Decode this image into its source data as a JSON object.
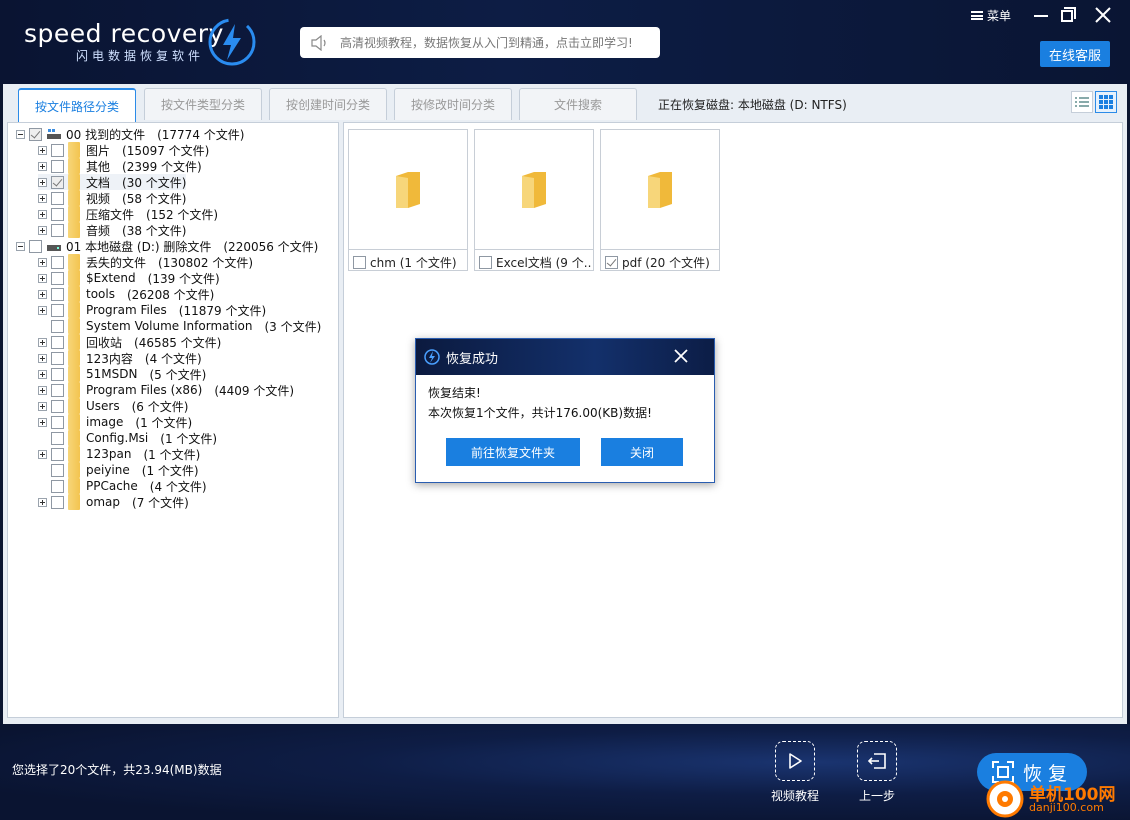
{
  "header": {
    "logo_en": "speed recovery",
    "logo_cn": "闪电数据恢复软件",
    "notice": "高清视频教程，数据恢复从入门到精通，点击立即学习!",
    "menu_label": "菜单",
    "online_service": "在线客服"
  },
  "tabs": [
    {
      "label": "按文件路径分类",
      "active": true
    },
    {
      "label": "按文件类型分类",
      "active": false
    },
    {
      "label": "按创建时间分类",
      "active": false
    },
    {
      "label": "按修改时间分类",
      "active": false
    },
    {
      "label": "文件搜索",
      "active": false
    }
  ],
  "disk_status": "正在恢复磁盘: 本地磁盘 (D: NTFS)",
  "tree": [
    {
      "name": "00 找到的文件",
      "count": "(17774 个文件)"
    },
    {
      "name": "图片",
      "count": "(15097 个文件)"
    },
    {
      "name": "其他",
      "count": "(2399 个文件)"
    },
    {
      "name": "文档",
      "count": "(30 个文件)"
    },
    {
      "name": "视频",
      "count": "(58 个文件)"
    },
    {
      "name": "压缩文件",
      "count": "(152 个文件)"
    },
    {
      "name": "音频",
      "count": "(38 个文件)"
    },
    {
      "name": "01 本地磁盘 (D:) 删除文件",
      "count": "(220056 个文件)"
    },
    {
      "name": "丢失的文件",
      "count": "(130802 个文件)"
    },
    {
      "name": "$Extend",
      "count": "(139 个文件)"
    },
    {
      "name": "tools",
      "count": "(26208 个文件)"
    },
    {
      "name": "Program Files",
      "count": "(11879 个文件)"
    },
    {
      "name": "System Volume Information",
      "count": "(3 个文件)"
    },
    {
      "name": "回收站",
      "count": "(46585 个文件)"
    },
    {
      "name": "123内容",
      "count": "(4 个文件)"
    },
    {
      "name": "51MSDN",
      "count": "(5 个文件)"
    },
    {
      "name": "Program Files (x86)",
      "count": "(4409 个文件)"
    },
    {
      "name": "Users",
      "count": "(6 个文件)"
    },
    {
      "name": "image",
      "count": "(1 个文件)"
    },
    {
      "name": "Config.Msi",
      "count": "(1 个文件)"
    },
    {
      "name": "123pan",
      "count": "(1 个文件)"
    },
    {
      "name": "peiyine",
      "count": "(1 个文件)"
    },
    {
      "name": "PPCache",
      "count": "(4 个文件)"
    },
    {
      "name": "omap",
      "count": "(7 个文件)"
    }
  ],
  "files": [
    {
      "label": "chm",
      "count": "(1 个文件)",
      "checked": false
    },
    {
      "label": "Excel文档",
      "count": "(9 个...",
      "checked": false
    },
    {
      "label": "pdf",
      "count": "(20 个文件)",
      "checked": true
    }
  ],
  "dialog": {
    "title": "恢复成功",
    "line1": "恢复结束!",
    "line2": "本次恢复1个文件，共计176.00(KB)数据!",
    "open_folder": "前往恢复文件夹",
    "close": "关闭"
  },
  "footer": {
    "selection_info": "您选择了20个文件，共23.94(MB)数据",
    "video_tutorial": "视频教程",
    "prev_step": "上一步",
    "recover": "恢复"
  },
  "watermark": {
    "title": "单机100网",
    "url": "danji100.com"
  },
  "colors": {
    "accent": "#1a7fe0",
    "header_bg": "#0a1432",
    "folder": "#f3c44f",
    "watermark": "#ff7a00"
  }
}
